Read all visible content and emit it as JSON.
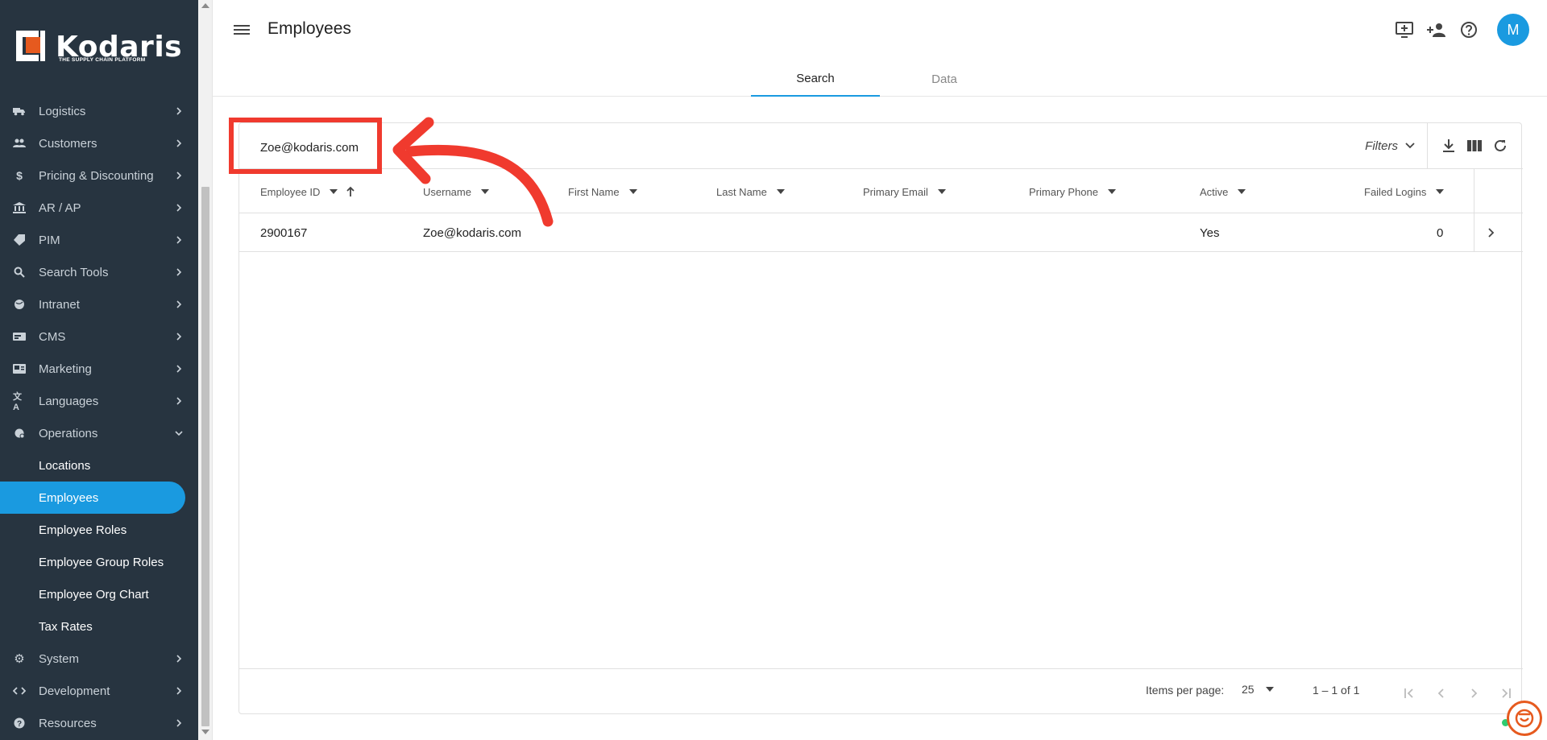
{
  "brand": {
    "name": "Kodaris",
    "tagline": "THE SUPPLY CHAIN PLATFORM",
    "accent": "#1a9ae0",
    "logo_orange": "#e65a1f"
  },
  "sidebar": {
    "items": [
      {
        "label": "Logistics",
        "icon": "truck-icon"
      },
      {
        "label": "Customers",
        "icon": "people-icon"
      },
      {
        "label": "Pricing & Discounting",
        "icon": "dollar-icon"
      },
      {
        "label": "AR / AP",
        "icon": "bank-icon"
      },
      {
        "label": "PIM",
        "icon": "tag-icon"
      },
      {
        "label": "Search Tools",
        "icon": "search-icon"
      },
      {
        "label": "Intranet",
        "icon": "globe-icon"
      },
      {
        "label": "CMS",
        "icon": "cms-icon"
      },
      {
        "label": "Marketing",
        "icon": "marketing-icon"
      },
      {
        "label": "Languages",
        "icon": "translate-icon"
      },
      {
        "label": "Operations",
        "icon": "operations-icon"
      }
    ],
    "sub_items": [
      {
        "label": "Locations"
      },
      {
        "label": "Employees"
      },
      {
        "label": "Employee Roles"
      },
      {
        "label": "Employee Group Roles"
      },
      {
        "label": "Employee Org Chart"
      },
      {
        "label": "Tax Rates"
      }
    ],
    "bottom_items": [
      {
        "label": "System",
        "icon": "gear-icon"
      },
      {
        "label": "Development",
        "icon": "code-icon"
      },
      {
        "label": "Resources",
        "icon": "help-icon"
      }
    ]
  },
  "header": {
    "title": "Employees",
    "avatar_initial": "M",
    "tabs": [
      {
        "label": "Search"
      },
      {
        "label": "Data"
      }
    ]
  },
  "search": {
    "value": "Zoe@kodaris.com"
  },
  "toolbar": {
    "filters_label": "Filters"
  },
  "table": {
    "columns": [
      {
        "label": "Employee ID"
      },
      {
        "label": "Username"
      },
      {
        "label": "First Name"
      },
      {
        "label": "Last Name"
      },
      {
        "label": "Primary Email"
      },
      {
        "label": "Primary Phone"
      },
      {
        "label": "Active"
      },
      {
        "label": "Failed Logins"
      }
    ],
    "rows": [
      {
        "employee_id": "2900167",
        "username": "Zoe@kodaris.com",
        "first_name": "",
        "last_name": "",
        "primary_email": "",
        "primary_phone": "",
        "active": "Yes",
        "failed_logins": "0"
      }
    ]
  },
  "pagination": {
    "items_per_page_label": "Items per page:",
    "items_per_page": "25",
    "range": "1 – 1 of 1"
  },
  "annotation": {
    "color": "#f03a2e"
  }
}
